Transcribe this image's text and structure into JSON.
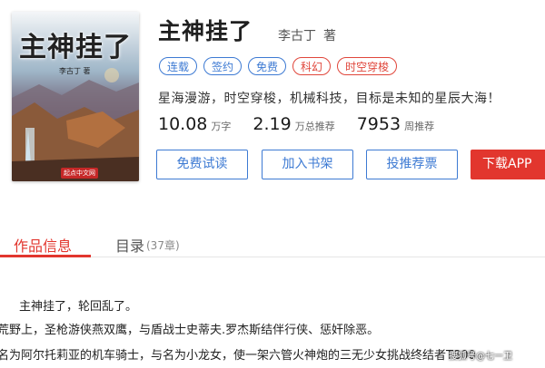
{
  "cover": {
    "title": "主神挂了",
    "author": "李古丁 著",
    "logo": "起点中文网"
  },
  "book": {
    "title": "主神挂了",
    "author": "李古丁",
    "author_suffix": "著"
  },
  "tags": [
    {
      "label": "连载",
      "color": "#3d7ad3"
    },
    {
      "label": "签约",
      "color": "#3d7ad3"
    },
    {
      "label": "免费",
      "color": "#3d7ad3"
    },
    {
      "label": "科幻",
      "color": "#e0463b"
    },
    {
      "label": "时空穿梭",
      "color": "#e0463b"
    }
  ],
  "intro": "星海漫游，时空穿梭，机械科技，目标是未知的星辰大海！",
  "stats": [
    {
      "value": "10.08",
      "unit": "万字"
    },
    {
      "value": "2.19",
      "unit": "万总推荐"
    },
    {
      "value": "7953",
      "unit": "周推荐"
    }
  ],
  "buttons": {
    "free_read": "免费试读",
    "add_shelf": "加入书架",
    "vote": "投推荐票",
    "download_app": "下载APP 新..."
  },
  "tabs": {
    "info": "作品信息",
    "catalog": "目录",
    "catalog_count": "(37章)"
  },
  "content": {
    "line1": "主神挂了，轮回乱了。",
    "line2": "荒野上，圣枪游侠燕双鹰，与盾战士史蒂夫.罗杰斯结伴行侠、惩奸除恶。",
    "line3": "名为阿尔托莉亚的机车骑士，与名为小龙女，使一架六管火神炮的三无少女挑战终结者T800"
  },
  "watermark": "搜狐号@七一卫",
  "colors": {
    "accent_blue": "#3d7ad3",
    "accent_red": "#e2362e"
  }
}
